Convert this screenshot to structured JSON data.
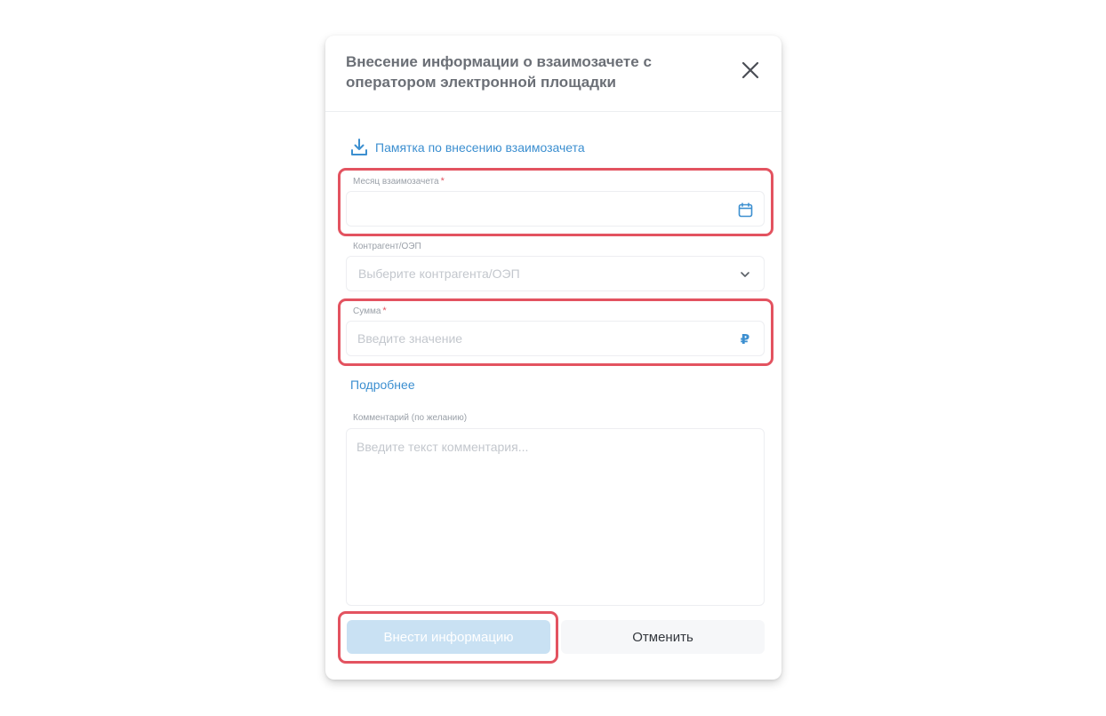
{
  "dialog": {
    "title": "Внесение информации о взаимозачете с оператором электронной площадки",
    "close_icon": "close-icon"
  },
  "memo_link": {
    "label": "Памятка по внесению взаимозачета",
    "icon": "download-icon"
  },
  "fields": {
    "month": {
      "label": "Месяц взаимозачета",
      "required_mark": "*",
      "value": "",
      "icon": "calendar-icon"
    },
    "counterparty": {
      "label": "Контрагент/ОЭП",
      "placeholder": "Выберите контрагента/ОЭП",
      "icon": "chevron-down-icon"
    },
    "amount": {
      "label": "Сумма",
      "required_mark": "*",
      "placeholder": "Введите значение",
      "currency_symbol": "₽"
    },
    "comment": {
      "label": "Комментарий (по желанию)",
      "placeholder": "Введите текст комментария..."
    }
  },
  "details_link": "Подробнее",
  "buttons": {
    "submit": "Внести информацию",
    "cancel": "Отменить"
  },
  "colors": {
    "accent": "#3c8fd0",
    "highlight": "#e35360",
    "required": "#e25563",
    "submit_disabled_bg": "#c9e1f3"
  }
}
